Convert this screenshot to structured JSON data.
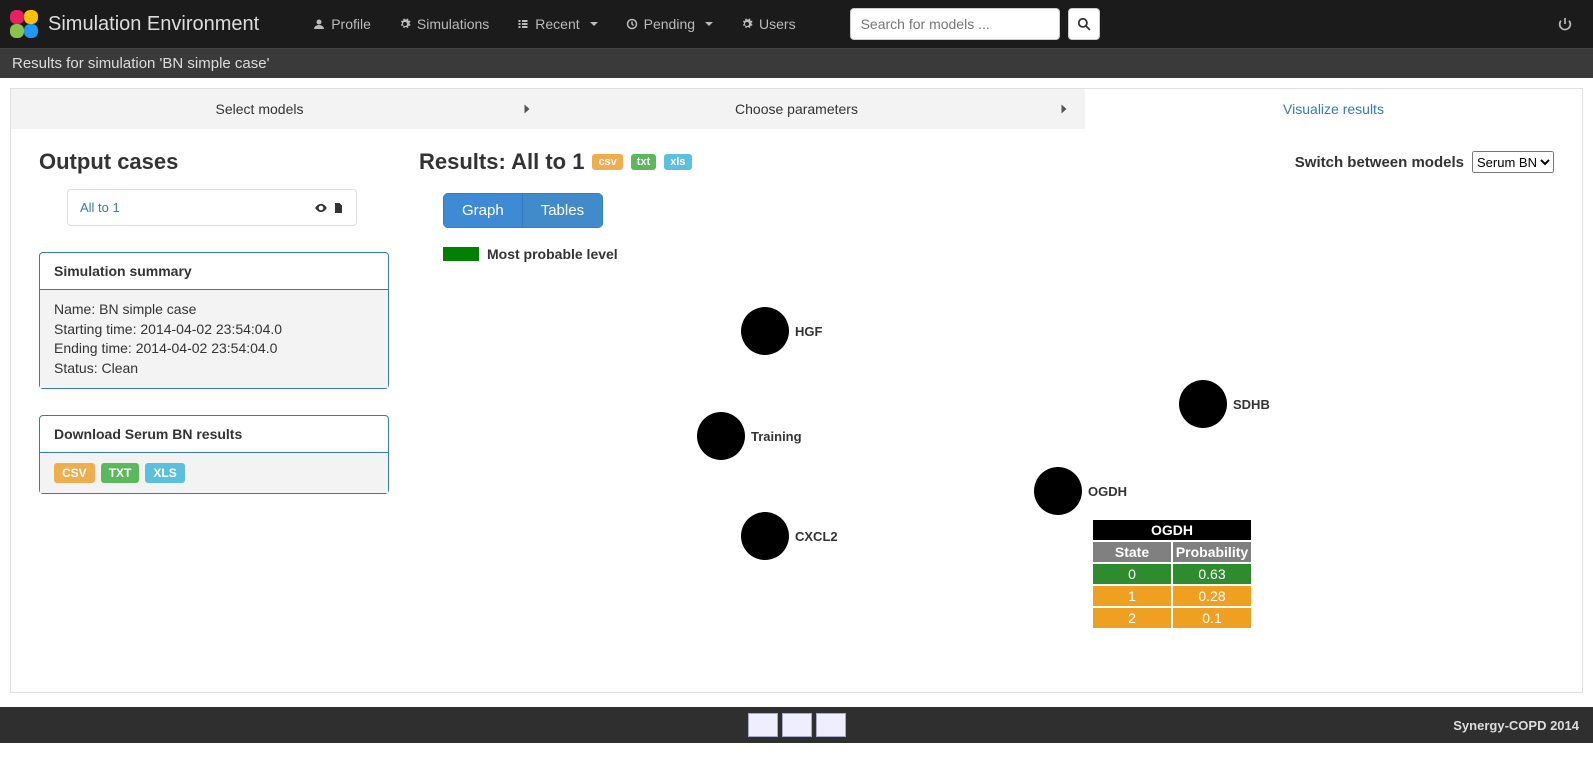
{
  "brand": "Simulation Environment",
  "nav": {
    "profile": "Profile",
    "simulations": "Simulations",
    "recent": "Recent",
    "pending": "Pending",
    "users": "Users",
    "search_placeholder": "Search for models ..."
  },
  "subheader": "Results for simulation 'BN simple case'",
  "wizard": {
    "step1": "Select models",
    "step2": "Choose parameters",
    "step3": "Visualize results"
  },
  "output_cases_title": "Output cases",
  "output_case": "All to 1",
  "summary_panel_title": "Simulation summary",
  "summary": {
    "name_label": "Name:",
    "name": "BN simple case",
    "start_label": "Starting time:",
    "start": "2014-04-02 23:54:04.0",
    "end_label": "Ending time:",
    "end": "2014-04-02 23:54:04.0",
    "status_label": "Status:",
    "status": "Clean"
  },
  "download_panel_title": "Download Serum BN results",
  "badges": {
    "csv": "CSV",
    "txt": "TXT",
    "xls": "XLS",
    "csv_sm": "csv",
    "txt_sm": "txt",
    "xls_sm": "xls"
  },
  "results_prefix": "Results:",
  "results_case": "All to 1",
  "switch_label": "Switch between models",
  "switch_selected": "Serum BN",
  "tabs": {
    "graph": "Graph",
    "tables": "Tables"
  },
  "legend": "Most probable level",
  "nodes": {
    "hgf": "HGF",
    "training": "Training",
    "cxcl2": "CXCL2",
    "sdhb": "SDHB",
    "ogdh": "OGDH"
  },
  "prob_table": {
    "title": "OGDH",
    "col_state": "State",
    "col_prob": "Probability",
    "rows": [
      {
        "state": "0",
        "prob": "0.63",
        "cls": "row-green"
      },
      {
        "state": "1",
        "prob": "0.28",
        "cls": "row-orange"
      },
      {
        "state": "2",
        "prob": "0.1",
        "cls": "row-orange"
      }
    ]
  },
  "footer": "Synergy-COPD 2014"
}
